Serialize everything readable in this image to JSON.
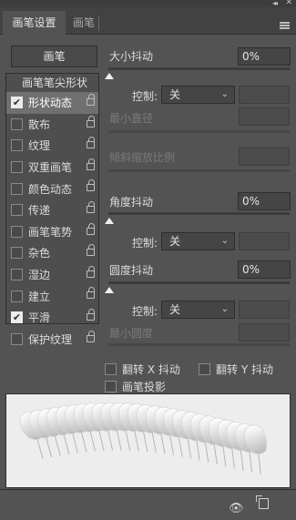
{
  "titlebar": {
    "collapse_glyph": "◂◂",
    "close_glyph": "✕"
  },
  "tabs": [
    {
      "label": "画笔设置",
      "active": true
    },
    {
      "label": "画笔",
      "active": false
    }
  ],
  "tab_close_glyph": "✕",
  "brush_button_label": "画笔",
  "sidebar": {
    "tip_shape_label": "画笔笔尖形状",
    "items": [
      {
        "label": "形状动态",
        "checked": true,
        "selected": true
      },
      {
        "label": "散布",
        "checked": false
      },
      {
        "label": "纹理",
        "checked": false
      },
      {
        "label": "双重画笔",
        "checked": false
      },
      {
        "label": "颜色动态",
        "checked": false
      },
      {
        "label": "传递",
        "checked": false
      },
      {
        "label": "画笔笔势",
        "checked": false
      },
      {
        "label": "杂色",
        "checked": false
      },
      {
        "label": "湿边",
        "checked": false
      },
      {
        "label": "建立",
        "checked": false
      },
      {
        "label": "平滑",
        "checked": true
      },
      {
        "label": "保护纹理",
        "checked": false
      }
    ]
  },
  "settings": {
    "size_jitter": {
      "label": "大小抖动",
      "value": "0%",
      "level": 0
    },
    "size_control": {
      "label": "控制:",
      "value": "关"
    },
    "min_diameter": {
      "label": "最小直径"
    },
    "tilt_scale": {
      "label": "倾斜缩放比例"
    },
    "angle_jitter": {
      "label": "角度抖动",
      "value": "0%",
      "level": 0
    },
    "angle_control": {
      "label": "控制:",
      "value": "关"
    },
    "roundness_jitter": {
      "label": "圆度抖动",
      "value": "0%",
      "level": 0
    },
    "roundness_control": {
      "label": "控制:",
      "value": "关"
    },
    "min_roundness": {
      "label": "最小圆度"
    }
  },
  "checkboxes": {
    "flip_x": {
      "label": "翻转 X 抖动",
      "checked": false
    },
    "flip_y": {
      "label": "翻转 Y 抖动",
      "checked": false
    },
    "brush_projection": {
      "label": "画笔投影",
      "checked": false
    }
  },
  "check_glyph": "✔",
  "chevron_glyph": "⌄",
  "bottom_icons": [
    "eye-icon",
    "new-preset-icon"
  ],
  "colors": {
    "panel_bg": "#535353",
    "preview_bg": "#ededed",
    "selected_row": "#707070"
  }
}
